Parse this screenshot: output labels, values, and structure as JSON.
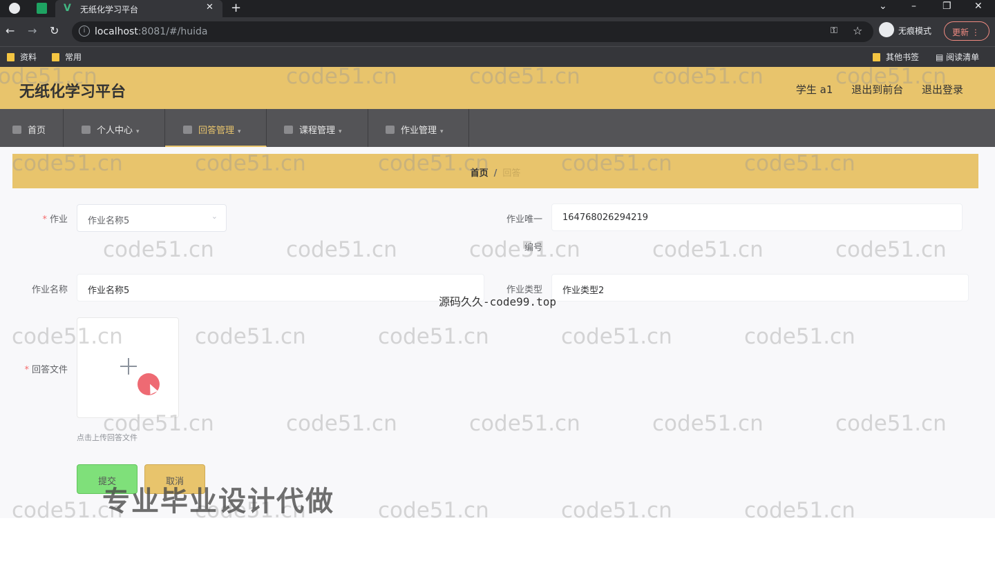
{
  "browser": {
    "tab_title": "无纸化学习平台",
    "tab_close": "✕",
    "new_tab": "+",
    "url_host": "localhost",
    "url_path": ":8081/#/huida",
    "incognito_label": "无痕模式",
    "update_label": "更新",
    "bookmarks": [
      "资料",
      "常用"
    ],
    "other_bookmarks": "其他书签",
    "reading_list": "阅读清单"
  },
  "header": {
    "title": "无纸化学习平台",
    "user": "学生 a1",
    "back_to_front": "退出到前台",
    "logout": "退出登录"
  },
  "nav": {
    "items": [
      {
        "label": "首页"
      },
      {
        "label": "个人中心"
      },
      {
        "label": "回答管理"
      },
      {
        "label": "课程管理"
      },
      {
        "label": "作业管理"
      }
    ]
  },
  "breadcrumb": {
    "home": "首页",
    "separator": "/",
    "current": "回答"
  },
  "form": {
    "homework_label": "作业",
    "homework_selected": "作业名称5",
    "homework_id_label_1": "作业唯一",
    "homework_id_label_2": "编号",
    "homework_id_value": "164768026294219",
    "homework_name_label": "作业名称",
    "homework_name_value": "作业名称5",
    "homework_type_label": "作业类型",
    "homework_type_value": "作业类型2",
    "answer_file_label": "回答文件",
    "upload_tip": "点击上传回答文件",
    "submit_label": "提交",
    "cancel_label": "取消",
    "required_mark": "*"
  },
  "watermarks": {
    "repeat": "code51.cn",
    "center": "源码久久-code99.top",
    "big": "专业毕业设计代做"
  },
  "colors": {
    "header_bg": "#e8c46c",
    "nav_bg": "#545457",
    "submit_bg": "#7fe07a",
    "cancel_bg": "#e8c46c"
  }
}
